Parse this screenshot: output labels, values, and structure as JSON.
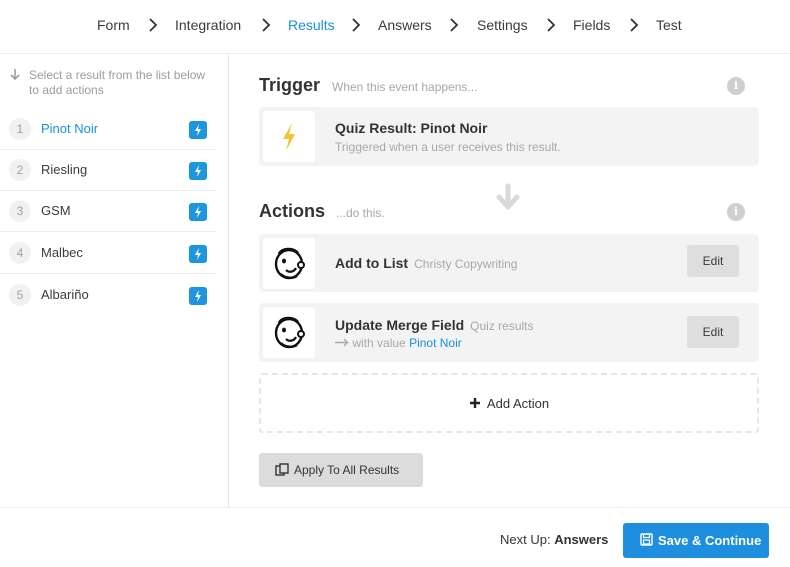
{
  "nav": {
    "steps": [
      "Form",
      "Integration",
      "Results",
      "Answers",
      "Settings",
      "Fields",
      "Test"
    ],
    "active": "Results"
  },
  "sidebar": {
    "hint": "Select a result from the list below to add actions",
    "results": [
      {
        "num": "1",
        "label": "Pinot Noir",
        "active": true
      },
      {
        "num": "2",
        "label": "Riesling"
      },
      {
        "num": "3",
        "label": "GSM"
      },
      {
        "num": "4",
        "label": "Malbec"
      },
      {
        "num": "5",
        "label": "Albariño"
      }
    ]
  },
  "trigger": {
    "title": "Trigger",
    "subtitle": "When this event happens...",
    "card_title": "Quiz Result: Pinot Noir",
    "card_subtitle": "Triggered when a user receives this result."
  },
  "actions": {
    "title": "Actions",
    "subtitle": "...do this.",
    "items": [
      {
        "title": "Add to List",
        "meta": "Christy Copywriting",
        "edit_label": "Edit"
      },
      {
        "title": "Update Merge Field",
        "meta": "Quiz results",
        "with_value_label": "with value",
        "value": "Pinot Noir",
        "edit_label": "Edit"
      }
    ],
    "add_label": "Add Action",
    "apply_label": "Apply To All Results"
  },
  "footer": {
    "next_up_label": "Next Up:",
    "next_up_value": "Answers",
    "save_label": "Save & Continue"
  },
  "colors": {
    "accent": "#1791d7",
    "bolt_yellow": "#f4c430"
  }
}
